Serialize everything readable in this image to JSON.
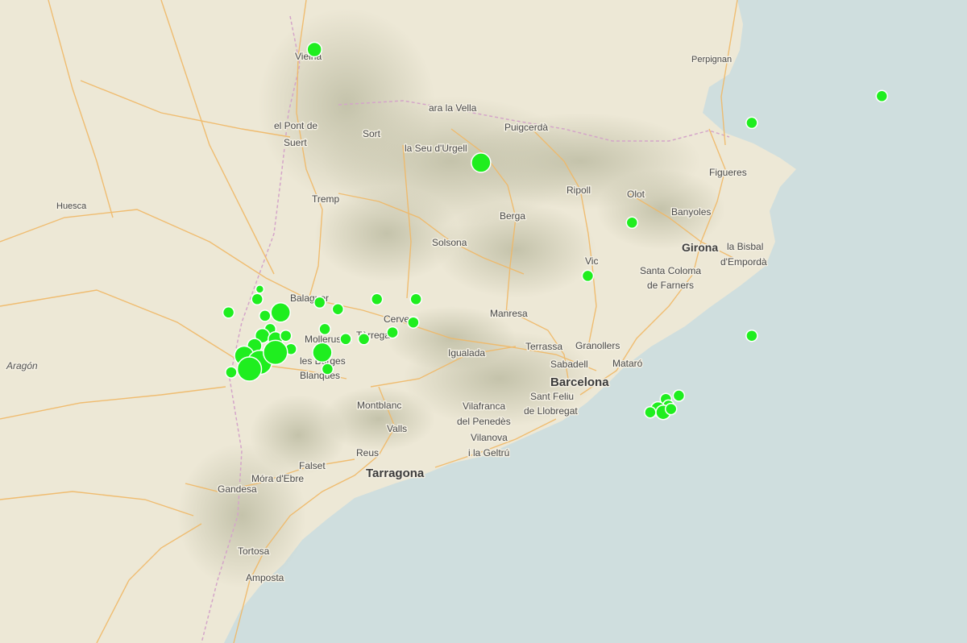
{
  "map": {
    "colors": {
      "sea": "#cfdede",
      "land": "#ede8d6",
      "relief": "#c9c7b0",
      "road": "#f0b866",
      "border": "#d4a5c9",
      "marker_fill": "#1fee1f",
      "marker_stroke": "#ffffff"
    },
    "labels": [
      {
        "text": "Perpignan",
        "kind": "small"
      },
      {
        "text": "Vielha",
        "kind": "city"
      },
      {
        "text": "el Pont de",
        "kind": "city"
      },
      {
        "text": "Suert",
        "kind": "city"
      },
      {
        "text": "Sort",
        "kind": "city"
      },
      {
        "text": "ara la Vella",
        "kind": "city"
      },
      {
        "text": "Puigcerdà",
        "kind": "city"
      },
      {
        "text": "la Seu d'Urgell",
        "kind": "city"
      },
      {
        "text": "Figueres",
        "kind": "city"
      },
      {
        "text": "Ripoll",
        "kind": "city"
      },
      {
        "text": "Olot",
        "kind": "city"
      },
      {
        "text": "Banyoles",
        "kind": "city"
      },
      {
        "text": "Huesca",
        "kind": "small"
      },
      {
        "text": "Tremp",
        "kind": "city"
      },
      {
        "text": "Berga",
        "kind": "city"
      },
      {
        "text": "Solsona",
        "kind": "city"
      },
      {
        "text": "Girona",
        "kind": "mid"
      },
      {
        "text": "la Bisbal",
        "kind": "city"
      },
      {
        "text": "d'Empordà",
        "kind": "city"
      },
      {
        "text": "Vic",
        "kind": "city"
      },
      {
        "text": "Santa Coloma",
        "kind": "city"
      },
      {
        "text": "de Farners",
        "kind": "city"
      },
      {
        "text": "Balaguer",
        "kind": "city"
      },
      {
        "text": "Manresa",
        "kind": "city"
      },
      {
        "text": "Cervera",
        "kind": "city"
      },
      {
        "text": "Mollerussa",
        "kind": "city"
      },
      {
        "text": "Tàrrega",
        "kind": "city"
      },
      {
        "text": "Terrassa",
        "kind": "city"
      },
      {
        "text": "Granollers",
        "kind": "city"
      },
      {
        "text": "Igualada",
        "kind": "city"
      },
      {
        "text": "les Borges",
        "kind": "city"
      },
      {
        "text": "Blanques",
        "kind": "city"
      },
      {
        "text": "Sabadell",
        "kind": "city"
      },
      {
        "text": "Mataró",
        "kind": "city"
      },
      {
        "text": "Aragón",
        "kind": "region"
      },
      {
        "text": "Barcelona",
        "kind": "major"
      },
      {
        "text": "Sant Feliu",
        "kind": "city"
      },
      {
        "text": "de Llobregat",
        "kind": "city"
      },
      {
        "text": "Montblanc",
        "kind": "city"
      },
      {
        "text": "Vilafranca",
        "kind": "city"
      },
      {
        "text": "del Penedès",
        "kind": "city"
      },
      {
        "text": "Valls",
        "kind": "city"
      },
      {
        "text": "Vilanova",
        "kind": "city"
      },
      {
        "text": "i la Geltrú",
        "kind": "city"
      },
      {
        "text": "Reus",
        "kind": "city"
      },
      {
        "text": "Tarragona",
        "kind": "major"
      },
      {
        "text": "Falset",
        "kind": "city"
      },
      {
        "text": "Móra d'Ebre",
        "kind": "city"
      },
      {
        "text": "Gandesa",
        "kind": "city"
      },
      {
        "text": "Tortosa",
        "kind": "city"
      },
      {
        "text": "Amposta",
        "kind": "city"
      }
    ],
    "markers": [
      {
        "lon": 0.77,
        "lat": 42.41,
        "size": 3
      },
      {
        "lon": 1.41,
        "lat": 42.07,
        "size": 4
      },
      {
        "lon": 2.95,
        "lat": 42.27,
        "size": 2
      },
      {
        "lon": 2.45,
        "lat": 42.19,
        "size": 2
      },
      {
        "lon": 1.99,
        "lat": 41.89,
        "size": 2
      },
      {
        "lon": 1.82,
        "lat": 41.73,
        "size": 2
      },
      {
        "lon": 2.45,
        "lat": 41.55,
        "size": 2
      },
      {
        "lon": 0.56,
        "lat": 41.69,
        "size": 1
      },
      {
        "lon": 0.55,
        "lat": 41.66,
        "size": 2
      },
      {
        "lon": 0.44,
        "lat": 41.62,
        "size": 2
      },
      {
        "lon": 0.58,
        "lat": 41.61,
        "size": 2
      },
      {
        "lon": 0.64,
        "lat": 41.62,
        "size": 4
      },
      {
        "lon": 0.79,
        "lat": 41.65,
        "size": 2
      },
      {
        "lon": 0.86,
        "lat": 41.63,
        "size": 2
      },
      {
        "lon": 1.01,
        "lat": 41.66,
        "size": 2
      },
      {
        "lon": 1.16,
        "lat": 41.66,
        "size": 2
      },
      {
        "lon": 1.15,
        "lat": 41.59,
        "size": 2
      },
      {
        "lon": 1.07,
        "lat": 41.56,
        "size": 2
      },
      {
        "lon": 0.81,
        "lat": 41.57,
        "size": 2
      },
      {
        "lon": 0.6,
        "lat": 41.57,
        "size": 2
      },
      {
        "lon": 0.57,
        "lat": 41.55,
        "size": 3
      },
      {
        "lon": 0.62,
        "lat": 41.54,
        "size": 3
      },
      {
        "lon": 0.66,
        "lat": 41.55,
        "size": 2
      },
      {
        "lon": 0.89,
        "lat": 41.54,
        "size": 2
      },
      {
        "lon": 0.8,
        "lat": 41.5,
        "size": 4
      },
      {
        "lon": 0.96,
        "lat": 41.54,
        "size": 2
      },
      {
        "lon": 0.68,
        "lat": 41.51,
        "size": 2
      },
      {
        "lon": 0.54,
        "lat": 41.52,
        "size": 3
      },
      {
        "lon": 0.5,
        "lat": 41.49,
        "size": 4
      },
      {
        "lon": 0.56,
        "lat": 41.47,
        "size": 5
      },
      {
        "lon": 0.62,
        "lat": 41.5,
        "size": 5
      },
      {
        "lon": 0.52,
        "lat": 41.45,
        "size": 5
      },
      {
        "lon": 0.45,
        "lat": 41.44,
        "size": 2
      },
      {
        "lon": 0.82,
        "lat": 41.45,
        "size": 2
      },
      {
        "lon": 2.12,
        "lat": 41.36,
        "size": 2
      },
      {
        "lon": 2.17,
        "lat": 41.37,
        "size": 2
      },
      {
        "lon": 2.13,
        "lat": 41.34,
        "size": 2
      },
      {
        "lon": 2.09,
        "lat": 41.33,
        "size": 3
      },
      {
        "lon": 2.11,
        "lat": 41.32,
        "size": 3
      },
      {
        "lon": 2.06,
        "lat": 41.32,
        "size": 2
      },
      {
        "lon": 2.14,
        "lat": 41.33,
        "size": 2
      }
    ]
  }
}
